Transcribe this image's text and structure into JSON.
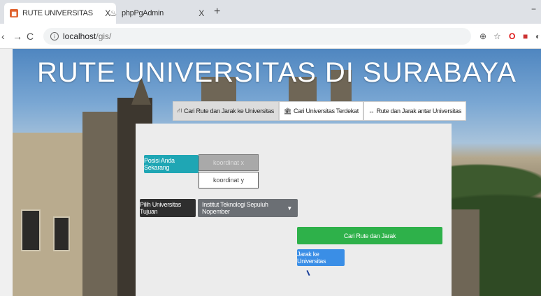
{
  "browser": {
    "tabs": [
      {
        "title": "RUTE UNIVERSITAS",
        "close": "X",
        "favicon": "gis-favicon"
      },
      {
        "title": "phpPgAdmin",
        "close": "X",
        "favicon": "elephant-icon"
      }
    ],
    "new_tab": "+",
    "minimize": "−",
    "url_host": "localhost",
    "url_path": "/gis/"
  },
  "page": {
    "title": "RUTE UNIVERSITAS DI SURABAYA",
    "nav": [
      {
        "label": "Cari Rute dan Jarak ke Universitas",
        "icon": "route-icon"
      },
      {
        "label": "Cari Universitas Terdekat",
        "icon": "university-icon"
      },
      {
        "label": "Rute dan Jarak antar Universitas",
        "icon": "arrows-icon"
      }
    ],
    "form": {
      "position_button": "Posisi Anda Sekarang",
      "coord_x_placeholder": "koordinat x",
      "coord_y_placeholder": "koordinat y",
      "choose_uni_button": "Pilih Universitas Tujuan",
      "selected_university": "Institut Teknologi Sepuluh Nopember",
      "search_button": "Cari Rute dan Jarak",
      "distance_button": "Jarak ke Universitas"
    }
  },
  "colors": {
    "teal": "#1fa6b4",
    "green": "#2eb14a",
    "blue": "#3a8ee6"
  }
}
